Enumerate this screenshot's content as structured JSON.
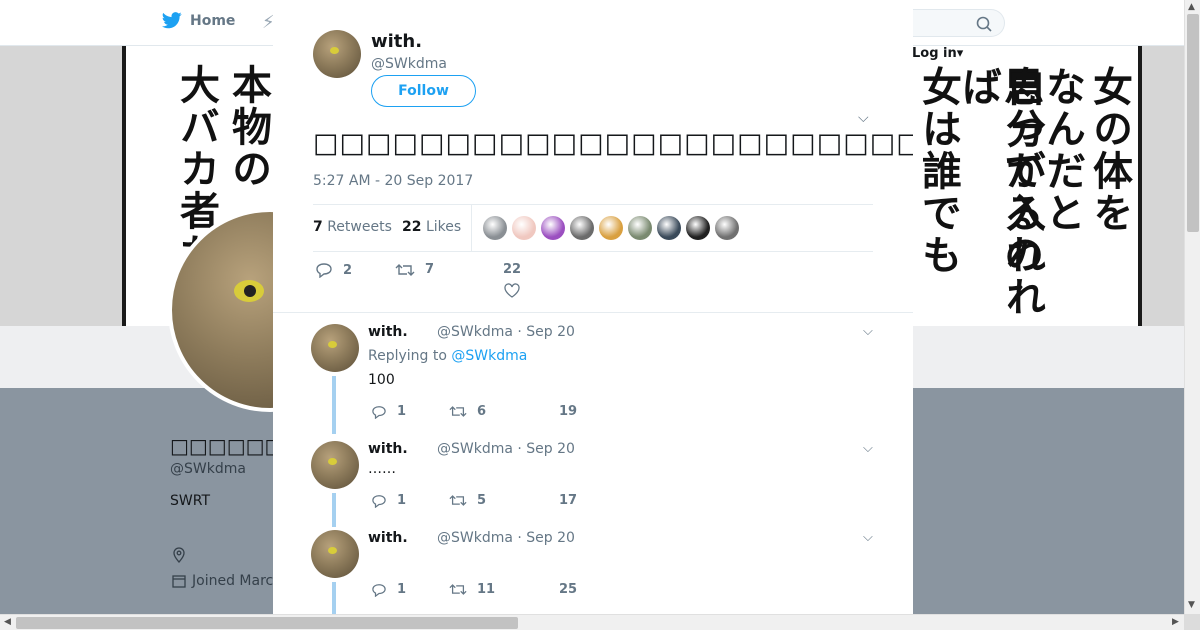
{
  "nav": {
    "home_label": "Home",
    "login_label": "Log in"
  },
  "banner": {
    "left_text": [
      "本物の",
      "大バカ者だ"
    ],
    "right_text": [
      "女の体を",
      "なんだと",
      "思ってるの",
      "自分が入れれば",
      "女は誰でも"
    ]
  },
  "profile": {
    "name": "□□□□□□with.",
    "handle": "@SWkdma",
    "bio": "SWRT",
    "joined": "Joined March"
  },
  "modal": {
    "author_name": "with.",
    "author_handle": "@SWkdma",
    "follow_label": "Follow",
    "tweet_text": "□□□□□□□□□□□□□□□□□□□□□□□□□□□□□□□□□□□□□□□□□□□□□□□□□□□□□□□□□",
    "timestamp": "5:27 AM - 20 Sep 2017",
    "retweets_count": "7",
    "retweets_label": "Retweets",
    "likes_count": "22",
    "likes_label": "Likes",
    "likers_colors": [
      "#8a8f94",
      "#f0c8c0",
      "#9b4fc0",
      "#6b6b6b",
      "#d9a040",
      "#7a8a70",
      "#3a4a5a",
      "#202020",
      "#707070"
    ],
    "actions": {
      "replies": "2",
      "retweets": "7",
      "likes": "22"
    }
  },
  "replies": [
    {
      "name": "with.",
      "meta": "@SWkdma · Sep 20",
      "replying_prefix": "Replying to",
      "replying_to": "@SWkdma",
      "text": "100",
      "replies": "1",
      "retweets": "6",
      "likes": "19"
    },
    {
      "name": "with.",
      "meta": "@SWkdma · Sep 20",
      "text": "……",
      "replies": "1",
      "retweets": "5",
      "likes": "17"
    },
    {
      "name": "with.",
      "meta": "@SWkdma · Sep 20",
      "text": "",
      "replies": "1",
      "retweets": "11",
      "likes": "25"
    }
  ],
  "colors": {
    "accent": "#1da1f2",
    "muted": "#657786",
    "thread": "#a5d0f0",
    "overlay": "#8a95a0"
  }
}
